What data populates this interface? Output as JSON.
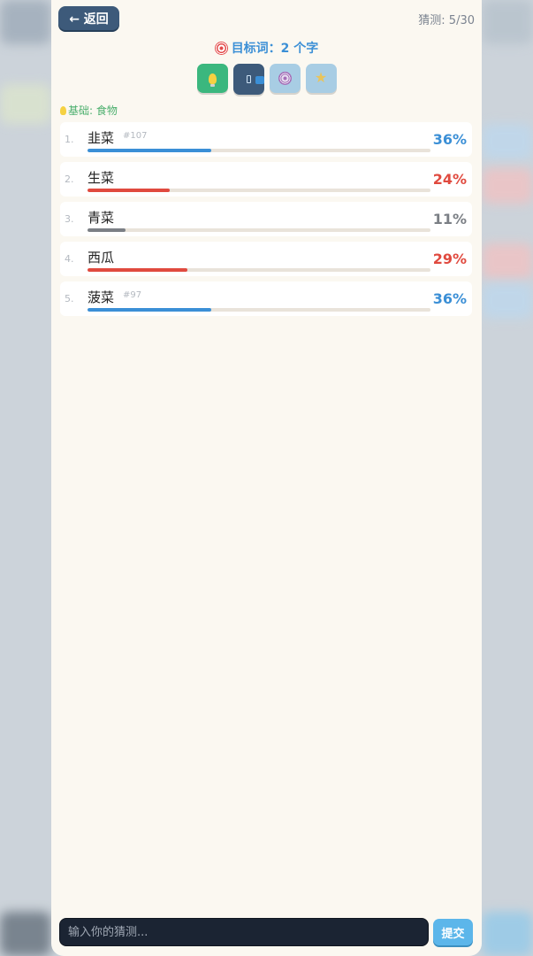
{
  "header": {
    "back_label": "← 返回",
    "guess_count": "猜测: 5/30"
  },
  "target": {
    "icon": "target-icon",
    "text": "目标词：2 个字"
  },
  "hints": [
    {
      "icon": "lightbulb-icon",
      "color": "#3bb77e",
      "active": true
    },
    {
      "icon": "phone-icon",
      "color": "#3d5a7a",
      "active": true
    },
    {
      "icon": "dart-icon",
      "color": "#a8cde4",
      "active": false
    },
    {
      "icon": "star-icon",
      "color": "#a8cde4",
      "active": false
    }
  ],
  "category": {
    "icon": "lightbulb-icon",
    "text": "基础: 食物"
  },
  "guesses": [
    {
      "rank": "1.",
      "word": "韭菜",
      "tag": "#107",
      "percent": "36%",
      "value": 0.36,
      "color": "#3b8fd6"
    },
    {
      "rank": "2.",
      "word": "生菜",
      "tag": "",
      "percent": "24%",
      "value": 0.24,
      "color": "#e04a3f"
    },
    {
      "rank": "3.",
      "word": "青菜",
      "tag": "",
      "percent": "11%",
      "value": 0.11,
      "color": "#7b7f85"
    },
    {
      "rank": "4.",
      "word": "西瓜",
      "tag": "",
      "percent": "29%",
      "value": 0.29,
      "color": "#e04a3f"
    },
    {
      "rank": "5.",
      "word": "菠菜",
      "tag": "#97",
      "percent": "36%",
      "value": 0.36,
      "color": "#3b8fd6"
    }
  ],
  "input": {
    "placeholder": "输入你的猜测...",
    "submit_label": "提交"
  }
}
